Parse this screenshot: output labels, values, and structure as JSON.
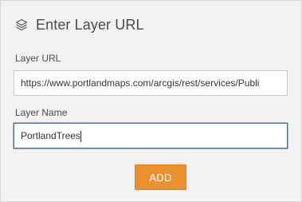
{
  "panel": {
    "title": "Enter Layer URL",
    "title_icon": "layers-icon"
  },
  "form": {
    "url_label": "Layer URL",
    "url_value": "https://www.portlandmaps.com/arcgis/rest/services/Publi",
    "name_label": "Layer Name",
    "name_value": "PortlandTrees"
  },
  "actions": {
    "add_label": "ADD",
    "add_color": "#e8912d"
  }
}
